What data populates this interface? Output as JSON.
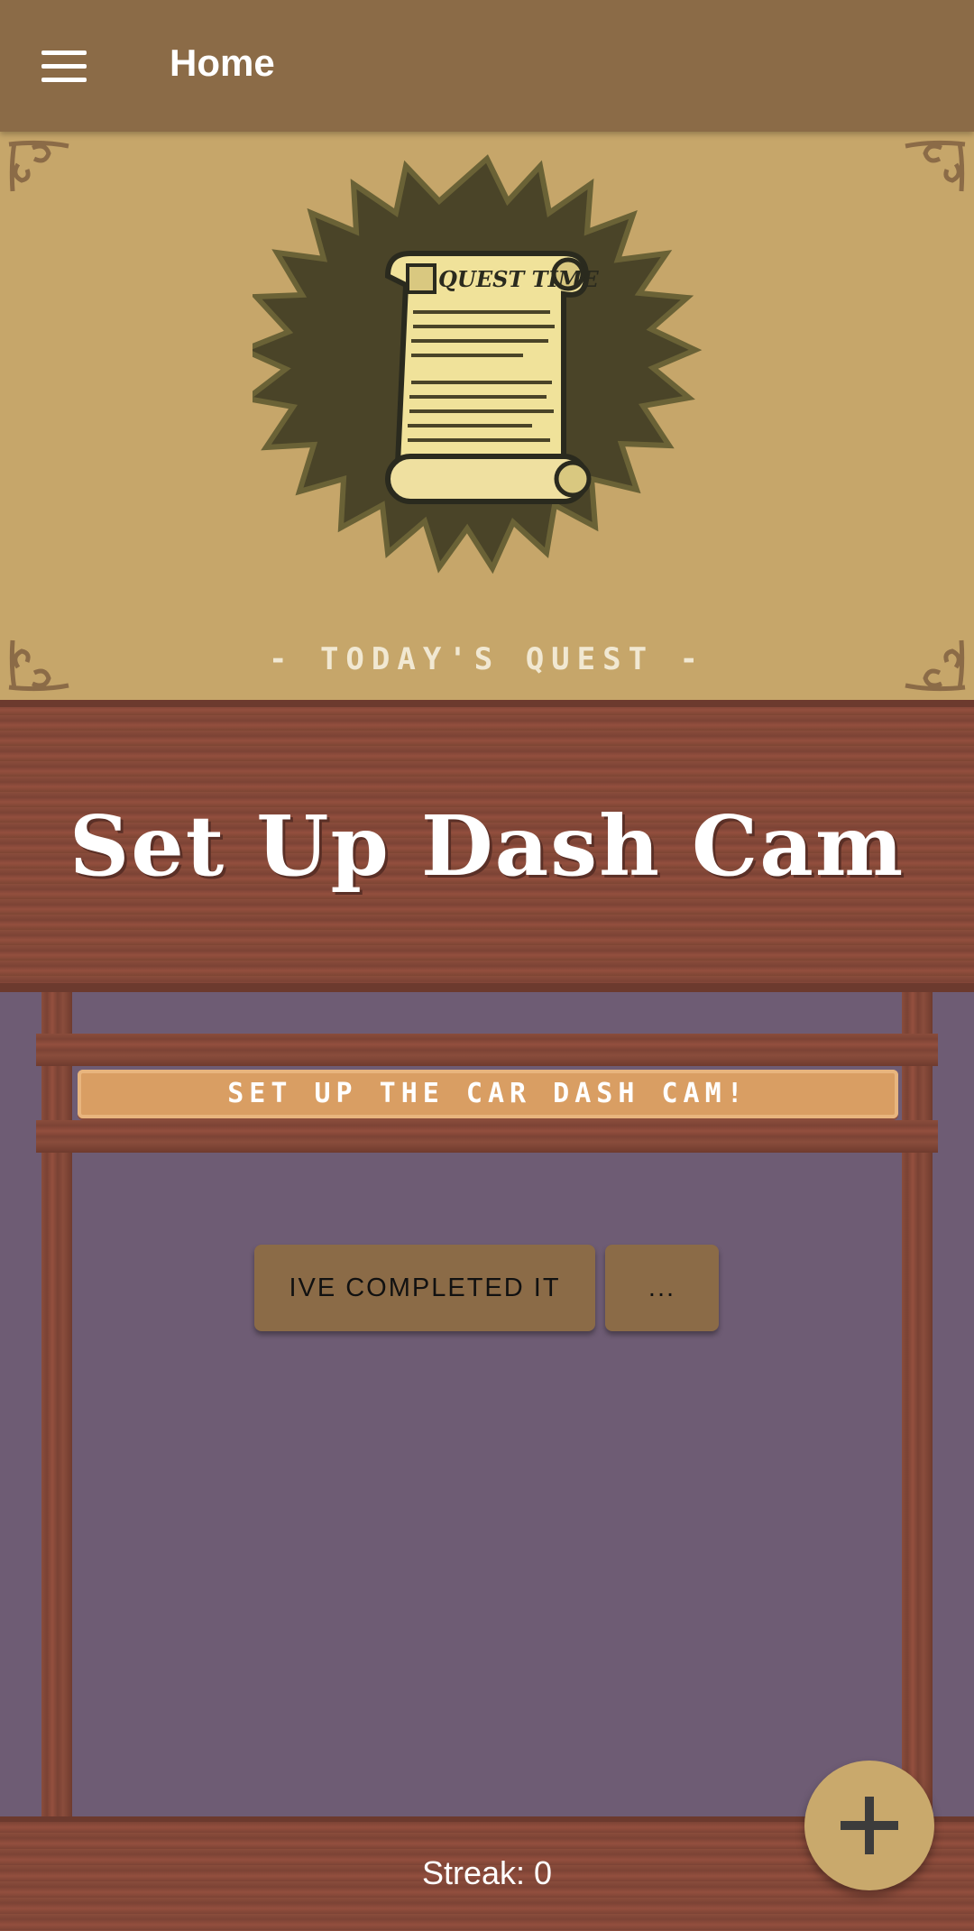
{
  "appbar": {
    "title": "Home"
  },
  "hero": {
    "scroll_heading": "QUEST TIME",
    "caption": "- TODAY'S QUEST -"
  },
  "quest": {
    "title": "Set Up Dash Cam",
    "description": "SET UP THE CAR DASH CAM!"
  },
  "actions": {
    "complete_label": "IVE COMPLETED IT",
    "more_label": "..."
  },
  "footer": {
    "streak": "Streak: 0"
  },
  "colors": {
    "appbar": "#8b6b47",
    "hero_bg": "#c6a66a",
    "badge": "#4a4428",
    "content_bg": "#6e5c74",
    "wood": "#8a4d3c",
    "plaque": "#d99e63",
    "fab": "#c9a96c"
  }
}
